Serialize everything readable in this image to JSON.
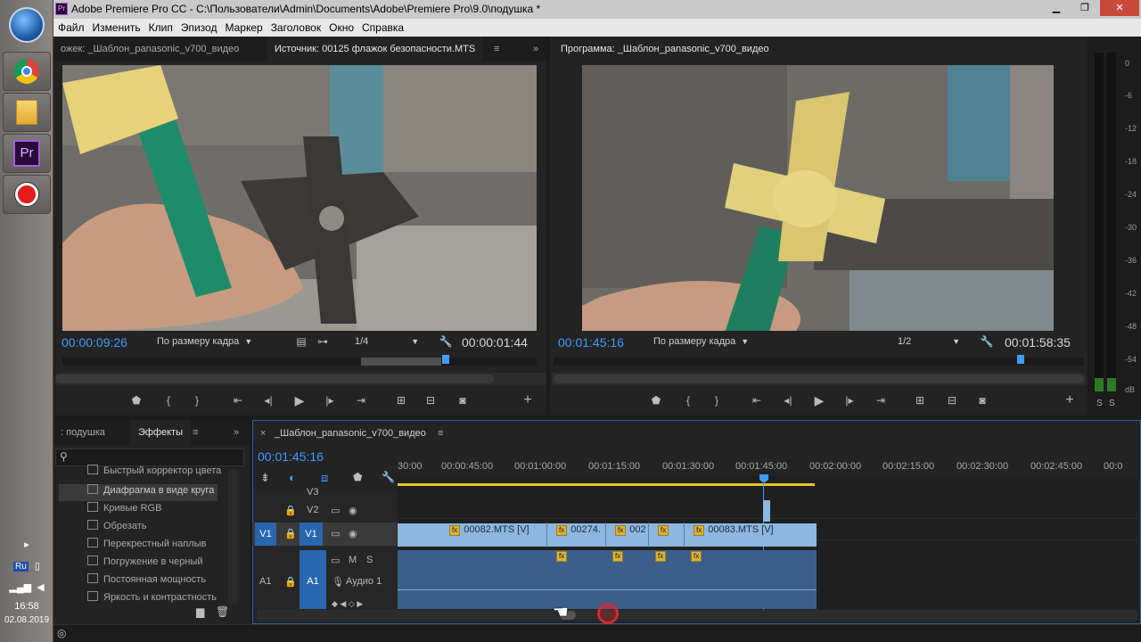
{
  "window": {
    "title": "Adobe Premiere Pro CC - C:\\Пользователи\\Admin\\Documents\\Adobe\\Premiere Pro\\9.0\\подушка *",
    "app_icon_text": "Pr"
  },
  "menu": [
    "Файл",
    "Изменить",
    "Клип",
    "Эпизод",
    "Маркер",
    "Заголовок",
    "Окно",
    "Справка"
  ],
  "taskbar": {
    "pr_label": "Pr",
    "lang": "Ru",
    "time": "16:58",
    "date": "02.08.2019"
  },
  "source_monitor": {
    "tab_prev": "ожек: _Шаблон_panasonic_v700_видео",
    "tab_active": "Источник: 00125 флажок безопасности.MTS",
    "timecode_in": "00:00:09:26",
    "fit": "По размеру кадра",
    "resolution": "1/4",
    "timecode_dur": "00:00:01:44"
  },
  "program_monitor": {
    "tab": "Программа: _Шаблон_panasonic_v700_видео",
    "timecode_in": "00:01:45:16",
    "fit": "По размеру кадра",
    "resolution": "1/2",
    "timecode_dur": "00:01:58:35"
  },
  "effects_panel": {
    "tab_project": ": подушка",
    "tab_effects": "Эффекты",
    "items": [
      "Быстрый корректор цвета",
      "Диафрагма в виде круга",
      "Кривые RGB",
      "Обрезать",
      "Перекрестный наплыв",
      "Погружение в черный",
      "Постоянная мощность",
      "Яркость и контрастность"
    ]
  },
  "timeline": {
    "tab": "_Шаблон_panasonic_v700_видео",
    "timecode": "00:01:45:16",
    "ruler": [
      "30:00",
      "00:00:45:00",
      "00:01:00:00",
      "00:01:15:00",
      "00:01:30:00",
      "00:01:45:00",
      "00:02:00:00",
      "00:02:15:00",
      "00:02:30:00",
      "00:02:45:00",
      "00:0"
    ],
    "tracks": {
      "v3": "V3",
      "v2": "V2",
      "v1_src": "V1",
      "v1": "V1",
      "a1_src": "A1",
      "a1": "A1",
      "audio_name": "Аудио 1",
      "m": "M",
      "s": "S"
    },
    "clips": [
      "00082.MTS [V]",
      "00274.",
      "002",
      "00083.MTS [V]"
    ],
    "fx": "fx"
  },
  "meter": {
    "labels": [
      "0",
      "-6",
      "-12",
      "-18",
      "-24",
      "-30",
      "-36",
      "-42",
      "-48",
      "-54",
      "dB"
    ],
    "s1": "S",
    "s2": "S"
  },
  "colors": {
    "accent_blue": "#3d9cff",
    "clip_video": "#8db7e0",
    "clip_audio": "#3b5f8a",
    "work_area_yellow": "#e8c225",
    "playhead": "#3d9cff"
  }
}
